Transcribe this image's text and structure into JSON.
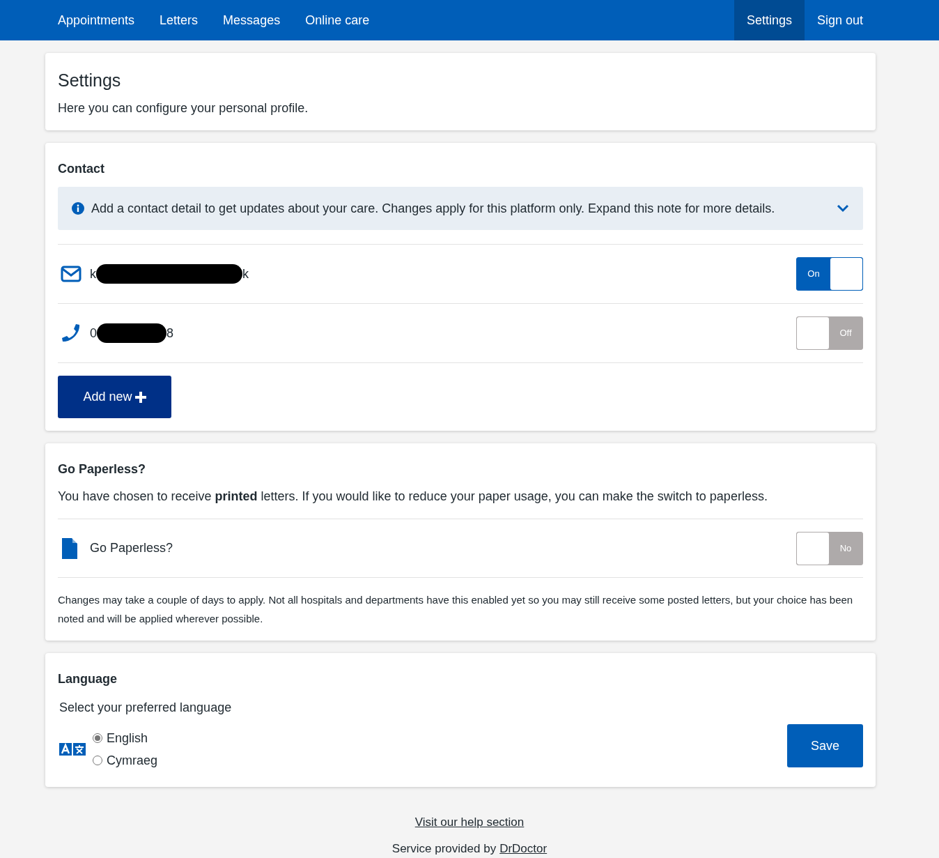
{
  "nav": {
    "items": [
      {
        "label": "Appointments",
        "selected": false
      },
      {
        "label": "Letters",
        "selected": false
      },
      {
        "label": "Messages",
        "selected": false
      },
      {
        "label": "Online care",
        "selected": false
      }
    ],
    "right_items": [
      {
        "label": "Settings",
        "selected": true
      },
      {
        "label": "Sign out",
        "selected": false
      }
    ]
  },
  "intro": {
    "title": "Settings",
    "text": "Here you can configure your personal profile."
  },
  "contact": {
    "title": "Contact",
    "note": {
      "text": "Add a contact detail to get updates about your care. Changes apply for this platform only. Expand this note for more details.",
      "expanded": false
    },
    "items": [
      {
        "kind": "email",
        "value_start": "k",
        "value_end": "k",
        "on": true,
        "toggle_label": "On"
      },
      {
        "kind": "phone",
        "value_start": "0",
        "value_end": "8",
        "on": false,
        "toggle_label": "Off"
      }
    ],
    "add_button": "Add new"
  },
  "paperless": {
    "title": "Go Paperless?",
    "text": "You have chosen to receive **printed** letters. If you would like to reduce your paper usage, you can make the switch to paperless.",
    "row": {
      "label": "Go Paperless?",
      "on": false,
      "toggle_label": "No"
    },
    "footnote": "Changes may take a couple of days to apply. Not all hospitals and departments have this enabled yet so you may still receive some posted letters, but your choice has been noted and will be applied wherever possible."
  },
  "language": {
    "title": "Language",
    "prompt": "Select your preferred language",
    "options": [
      {
        "label": "English",
        "selected": true
      },
      {
        "label": "Cymraeg",
        "selected": false
      }
    ],
    "save_button": "Save"
  },
  "footer": {
    "help_link": "Visit our help section",
    "provided_text": "Service provided by",
    "provider_link": "DrDoctor"
  }
}
